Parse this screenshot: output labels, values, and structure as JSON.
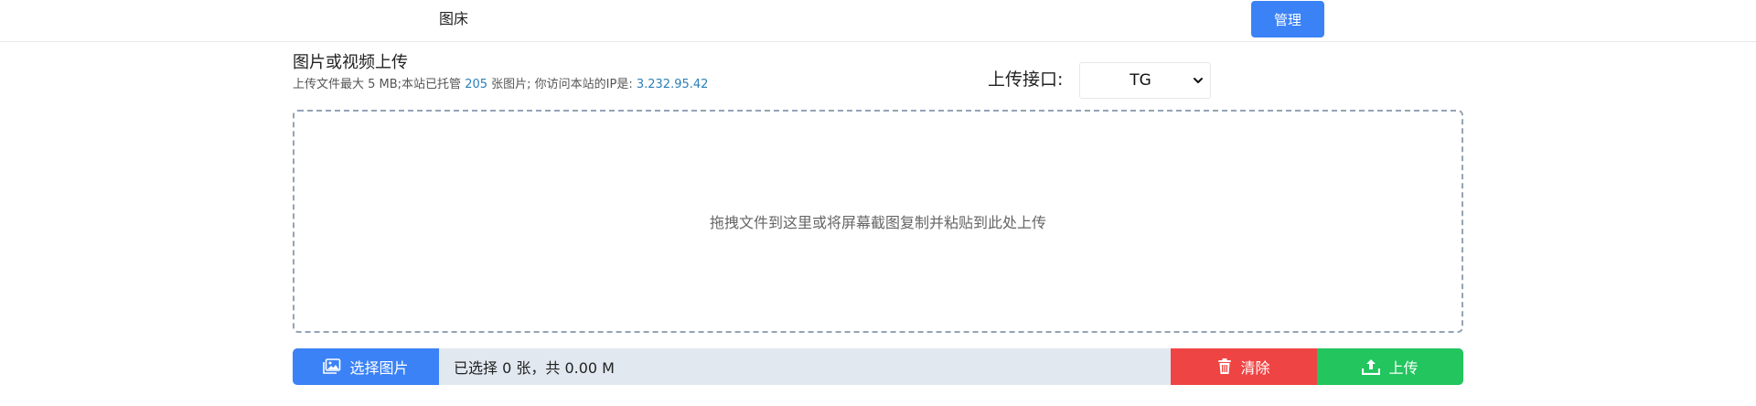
{
  "nav": {
    "brand": "图床",
    "admin_label": "管理"
  },
  "header": {
    "title": "图片或视频上传",
    "subtitle_prefix": "上传文件最大 5 MB;本站已托管 ",
    "hosted_count": "205",
    "subtitle_middle": " 张图片; 你访问本站的IP是: ",
    "ip": "3.232.95.42"
  },
  "api": {
    "label": "上传接口:",
    "selected": "TG"
  },
  "dropzone": {
    "hint": "拖拽文件到这里或将屏幕截图复制并粘贴到此处上传"
  },
  "actions": {
    "select_label": "选择图片",
    "status": "已选择 0 张，共 0.00 M",
    "clear_label": "清除",
    "upload_label": "上传"
  },
  "colors": {
    "primary": "#3b82f6",
    "danger": "#ef4444",
    "success": "#22c55e",
    "link": "#2a7fb8"
  }
}
